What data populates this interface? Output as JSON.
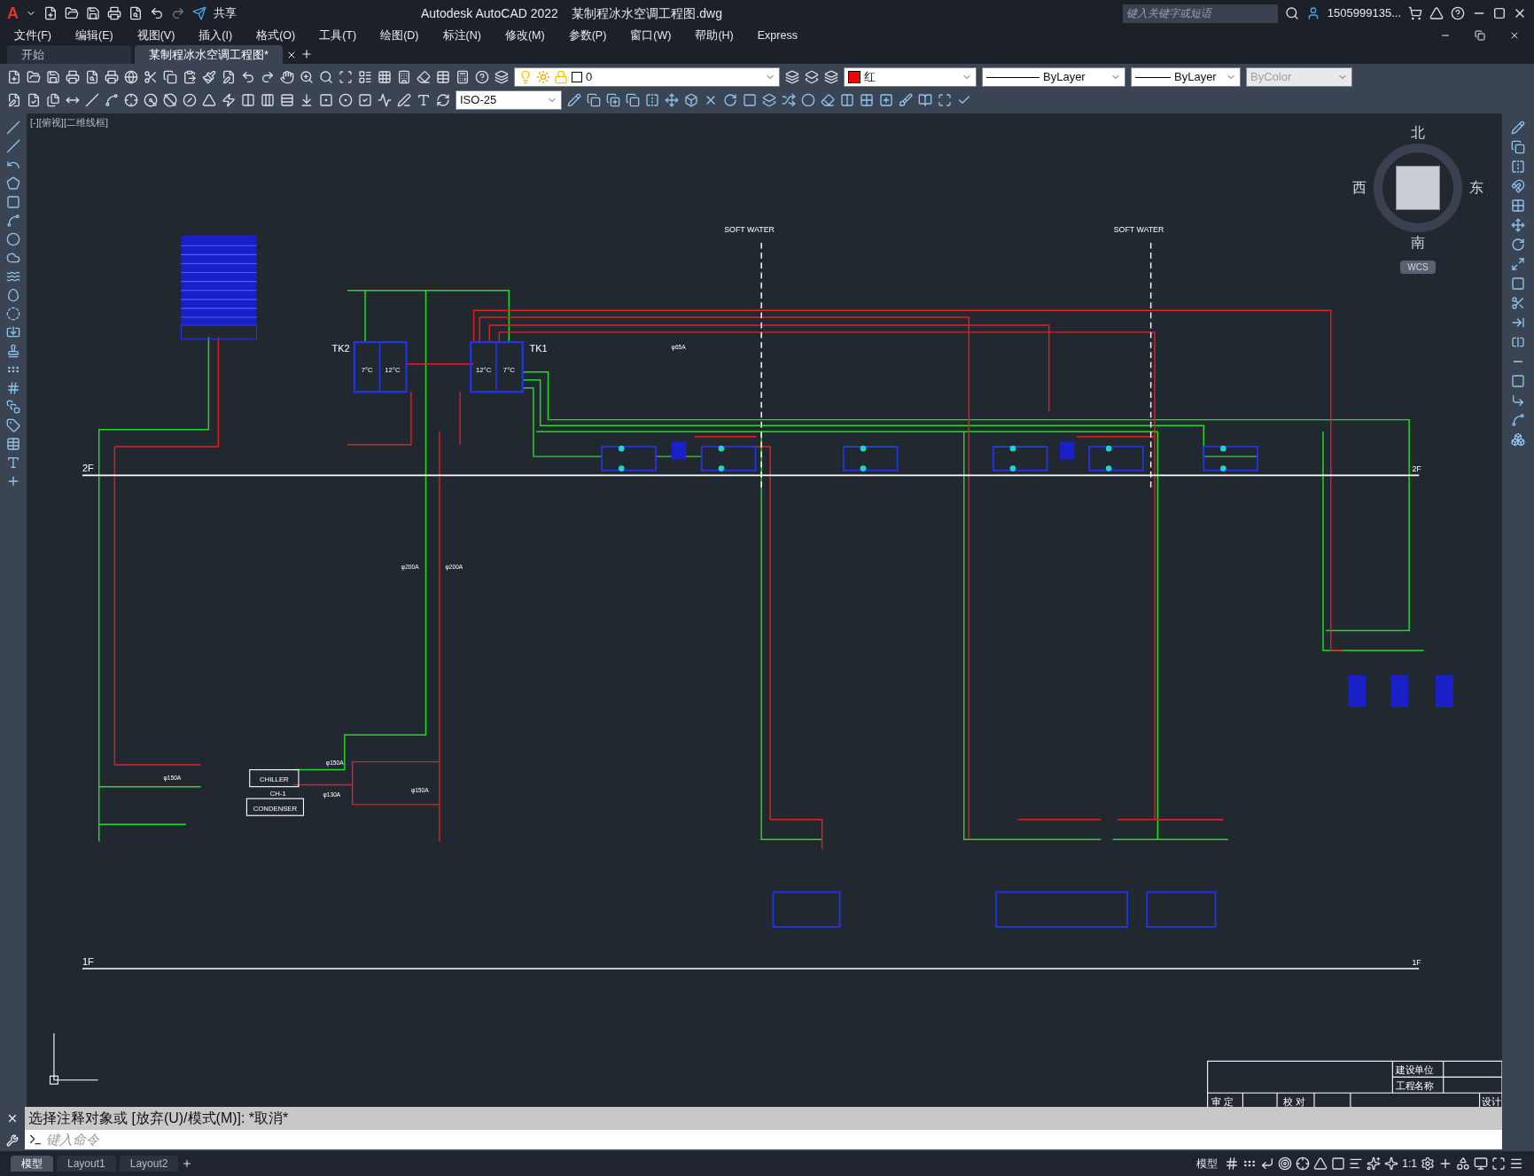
{
  "app": {
    "logo": "A",
    "share": "共享",
    "title": "Autodesk AutoCAD 2022    某制程冰水空调工程图.dwg",
    "search": {
      "placeholder": "键入关键字或短语"
    },
    "user": "1505999135..."
  },
  "menu": [
    "文件(F)",
    "编辑(E)",
    "视图(V)",
    "插入(I)",
    "格式(O)",
    "工具(T)",
    "绘图(D)",
    "标注(N)",
    "修改(M)",
    "参数(P)",
    "窗口(W)",
    "帮助(H)",
    "Express"
  ],
  "doc_tabs": [
    {
      "label": "开始",
      "selected": false
    },
    {
      "label": "某制程冰水空调工程图*",
      "selected": true
    }
  ],
  "properties": {
    "layer": "0",
    "color_name": "红",
    "linetype": "ByLayer",
    "lineweight": "ByLayer",
    "plot_style": {
      "value": "ByColor",
      "disabled": true
    },
    "dim_style": "ISO-25"
  },
  "viewport_label": "[-][俯视][二维线框]",
  "viewcube": {
    "north": "北",
    "south": "南",
    "east": "东",
    "west": "西",
    "ucs": "WCS"
  },
  "drawing": {
    "floors": [
      {
        "left": "2F",
        "right": "2F"
      },
      {
        "left": "1F",
        "right": "1F"
      }
    ],
    "tanks": [
      {
        "name": "TK2",
        "cells": [
          "7°C",
          "12°C"
        ]
      },
      {
        "name": "TK1",
        "cells": [
          "12°C",
          "7°C"
        ]
      }
    ],
    "chiller": {
      "label": "CHILLER",
      "id": "CH-1",
      "condenser": "CONDENSER"
    },
    "soft_water": [
      "SOFT WATER",
      "SOFT WATER"
    ],
    "pipe_sizes": [
      "φ150A",
      "φ150A",
      "φ130A",
      "φ150A",
      "φ200A",
      "φ200A",
      "φ65A"
    ],
    "title_block": [
      "建设单位",
      "工程名称",
      "审 定",
      "校 对",
      "设计"
    ]
  },
  "command": {
    "history": "选择注释对象或 [放弃(U)/模式(M)]: *取消*",
    "placeholder": "键入命令"
  },
  "layout_tabs": [
    {
      "label": "模型",
      "selected": true
    },
    {
      "label": "Layout1",
      "selected": false
    },
    {
      "label": "Layout2",
      "selected": false
    }
  ],
  "status": {
    "mode": "模型",
    "scale": "1:1"
  }
}
